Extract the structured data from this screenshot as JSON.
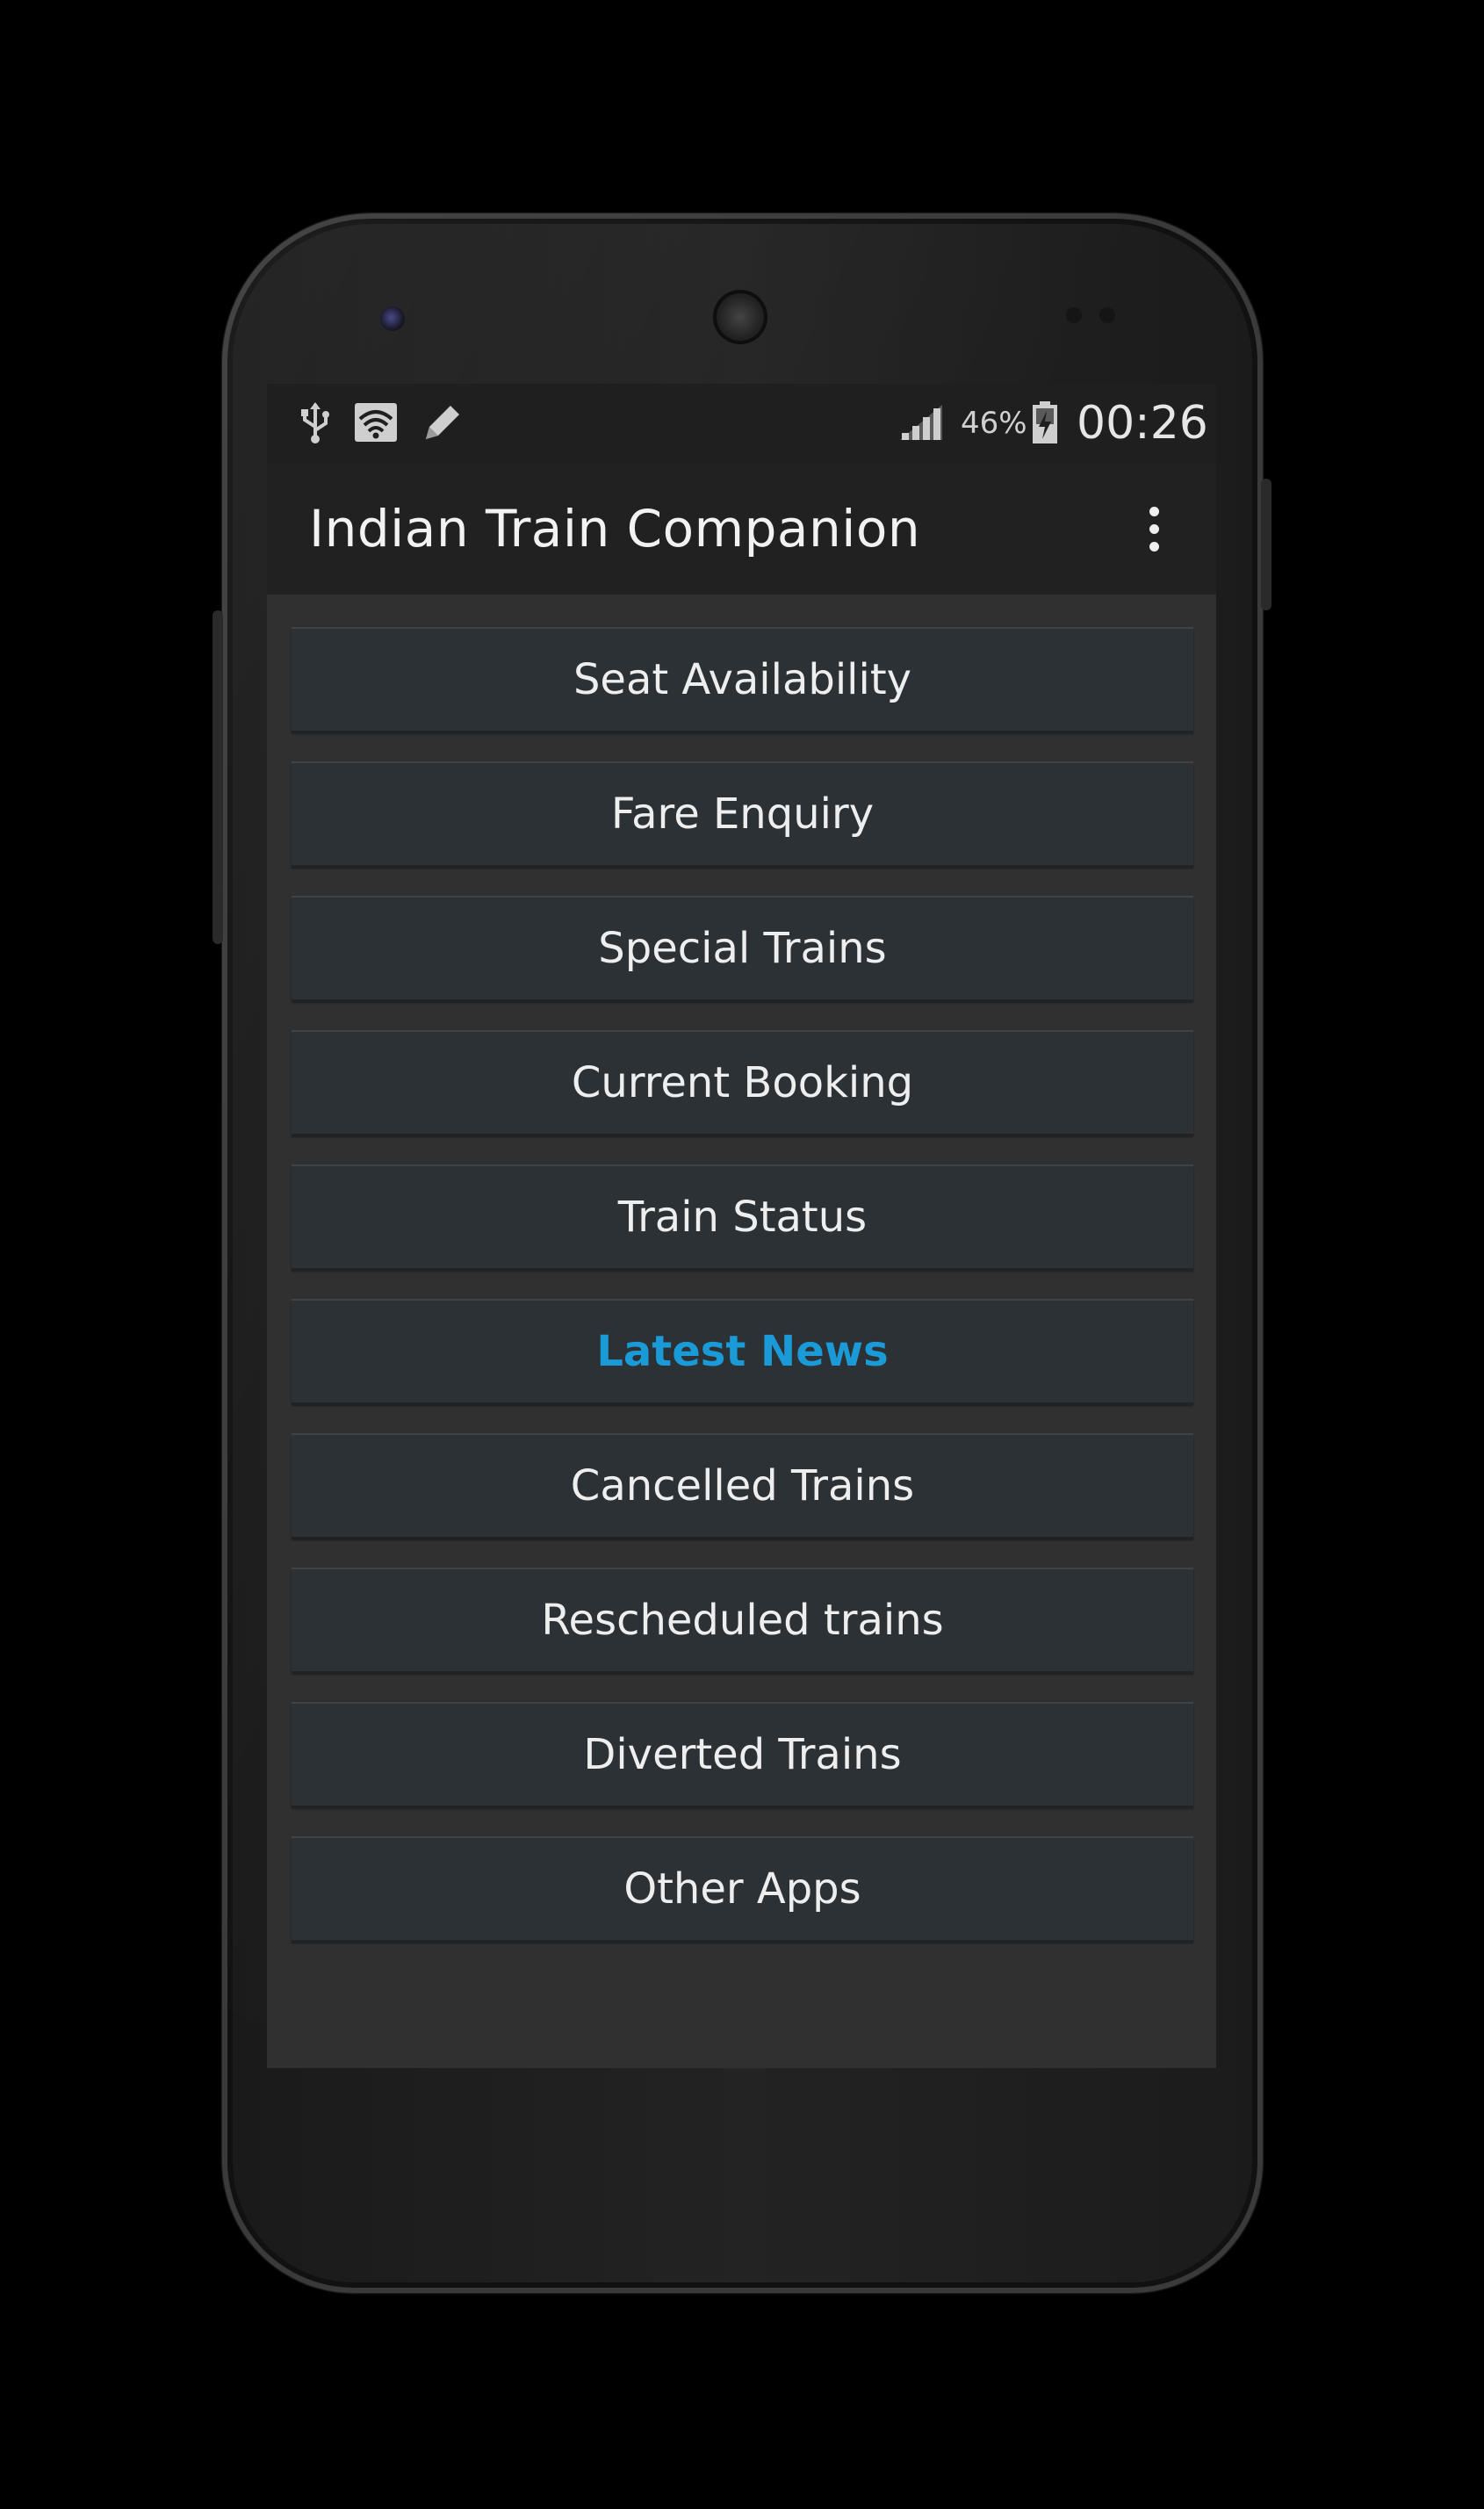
{
  "status_bar": {
    "icons_left": [
      "usb-icon",
      "wifi-icon",
      "edit-icon"
    ],
    "icons_right": [
      "signal-icon",
      "battery-charging-icon"
    ],
    "battery": "46%",
    "time": "00:26"
  },
  "app_bar": {
    "title": "Indian Train Companion",
    "overflow_icon": "more-vert-icon"
  },
  "menu": {
    "items": [
      {
        "label": "Seat Availability"
      },
      {
        "label": "Fare Enquiry"
      },
      {
        "label": "Special Trains"
      },
      {
        "label": "Current Booking"
      },
      {
        "label": "Train Status"
      },
      {
        "label": "Latest News",
        "highlighted": true
      },
      {
        "label": "Cancelled Trains"
      },
      {
        "label": "Rescheduled trains"
      },
      {
        "label": "Diverted Trains"
      },
      {
        "label": "Other Apps"
      }
    ]
  },
  "colors": {
    "accent": "#1a9ad6",
    "screen_bg": "#303030",
    "app_bar_bg": "#212121",
    "button_bg": "#2c3135"
  }
}
